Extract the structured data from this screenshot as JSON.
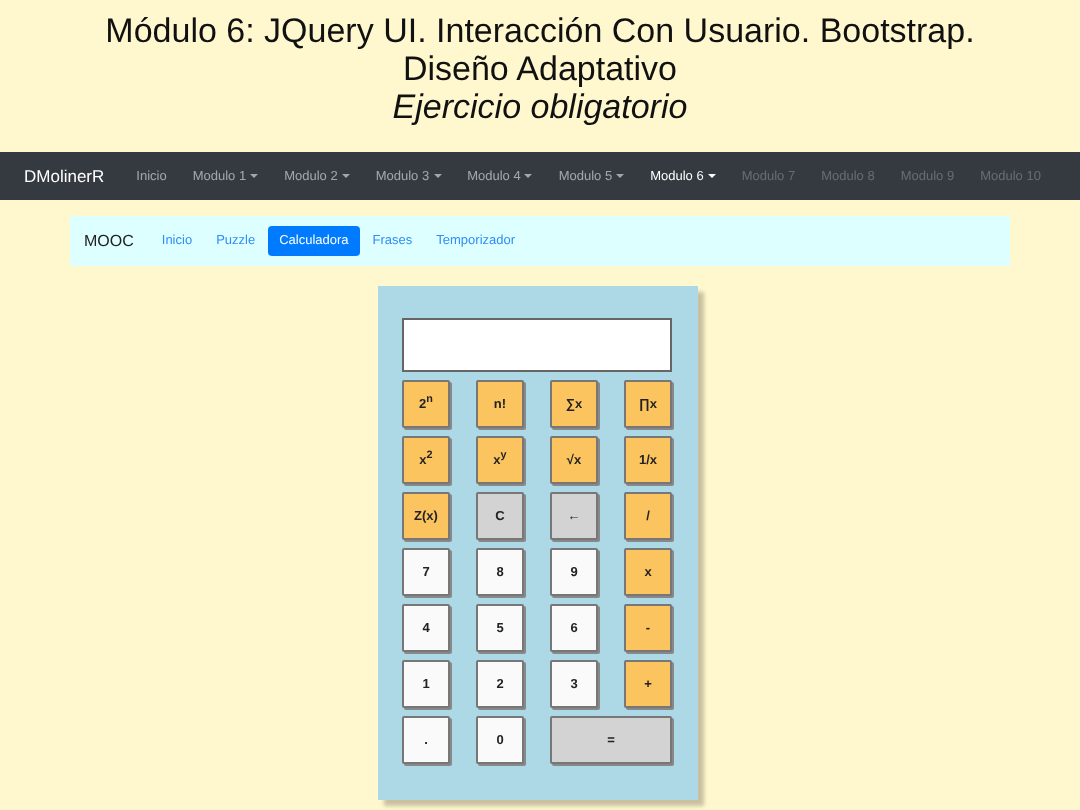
{
  "header": {
    "title": "Módulo 6: JQuery UI. Interacción Con Usuario. Bootstrap. Diseño Adaptativo",
    "subtitle": "Ejercicio obligatorio"
  },
  "navbar": {
    "brand": "DMolinerR",
    "items": [
      {
        "label": "Inicio",
        "dropdown": false,
        "selected": false,
        "disabled": false
      },
      {
        "label": "Modulo 1",
        "dropdown": true,
        "selected": false,
        "disabled": false
      },
      {
        "label": "Modulo 2",
        "dropdown": true,
        "selected": false,
        "disabled": false
      },
      {
        "label": "Modulo 3",
        "dropdown": true,
        "selected": false,
        "disabled": false
      },
      {
        "label": "Modulo 4",
        "dropdown": true,
        "selected": false,
        "disabled": false
      },
      {
        "label": "Modulo 5",
        "dropdown": true,
        "selected": false,
        "disabled": false
      },
      {
        "label": "Modulo 6",
        "dropdown": true,
        "selected": true,
        "disabled": false
      },
      {
        "label": "Modulo 7",
        "dropdown": false,
        "selected": false,
        "disabled": true
      },
      {
        "label": "Modulo 8",
        "dropdown": false,
        "selected": false,
        "disabled": true
      },
      {
        "label": "Modulo 9",
        "dropdown": false,
        "selected": false,
        "disabled": true
      },
      {
        "label": "Modulo 10",
        "dropdown": false,
        "selected": false,
        "disabled": true
      }
    ]
  },
  "subnav": {
    "brand": "MOOC",
    "items": [
      {
        "label": "Inicio",
        "selected": false
      },
      {
        "label": "Puzzle",
        "selected": false
      },
      {
        "label": "Calculadora",
        "selected": true
      },
      {
        "label": "Frases",
        "selected": false
      },
      {
        "label": "Temporizador",
        "selected": false
      }
    ]
  },
  "calculator": {
    "keys": [
      {
        "label": "2$^{n}$",
        "kind": "func"
      },
      {
        "label": "n!",
        "kind": "func"
      },
      {
        "label": "∑x",
        "kind": "func"
      },
      {
        "label": "∏x",
        "kind": "func"
      },
      {
        "label": "x$^{2}$",
        "kind": "func"
      },
      {
        "label": "x$^{y}$",
        "kind": "func"
      },
      {
        "label": "√x",
        "kind": "func"
      },
      {
        "label": "1/x",
        "kind": "func"
      },
      {
        "label": "Z(x)",
        "kind": "func"
      },
      {
        "label": "C",
        "kind": "clear"
      },
      {
        "label": "←",
        "kind": "clear"
      },
      {
        "label": "/",
        "kind": "func"
      },
      {
        "label": "7",
        "kind": "digit"
      },
      {
        "label": "8",
        "kind": "digit"
      },
      {
        "label": "9",
        "kind": "digit"
      },
      {
        "label": "x",
        "kind": "func"
      },
      {
        "label": "4",
        "kind": "digit"
      },
      {
        "label": "5",
        "kind": "digit"
      },
      {
        "label": "6",
        "kind": "digit"
      },
      {
        "label": "-",
        "kind": "func"
      },
      {
        "label": "1",
        "kind": "digit"
      },
      {
        "label": "2",
        "kind": "digit"
      },
      {
        "label": "3",
        "kind": "digit"
      },
      {
        "label": "+",
        "kind": "func"
      },
      {
        "label": ".",
        "kind": "digit"
      },
      {
        "label": "0",
        "kind": "digit"
      },
      {
        "label": "=",
        "kind": "equals"
      }
    ]
  }
}
